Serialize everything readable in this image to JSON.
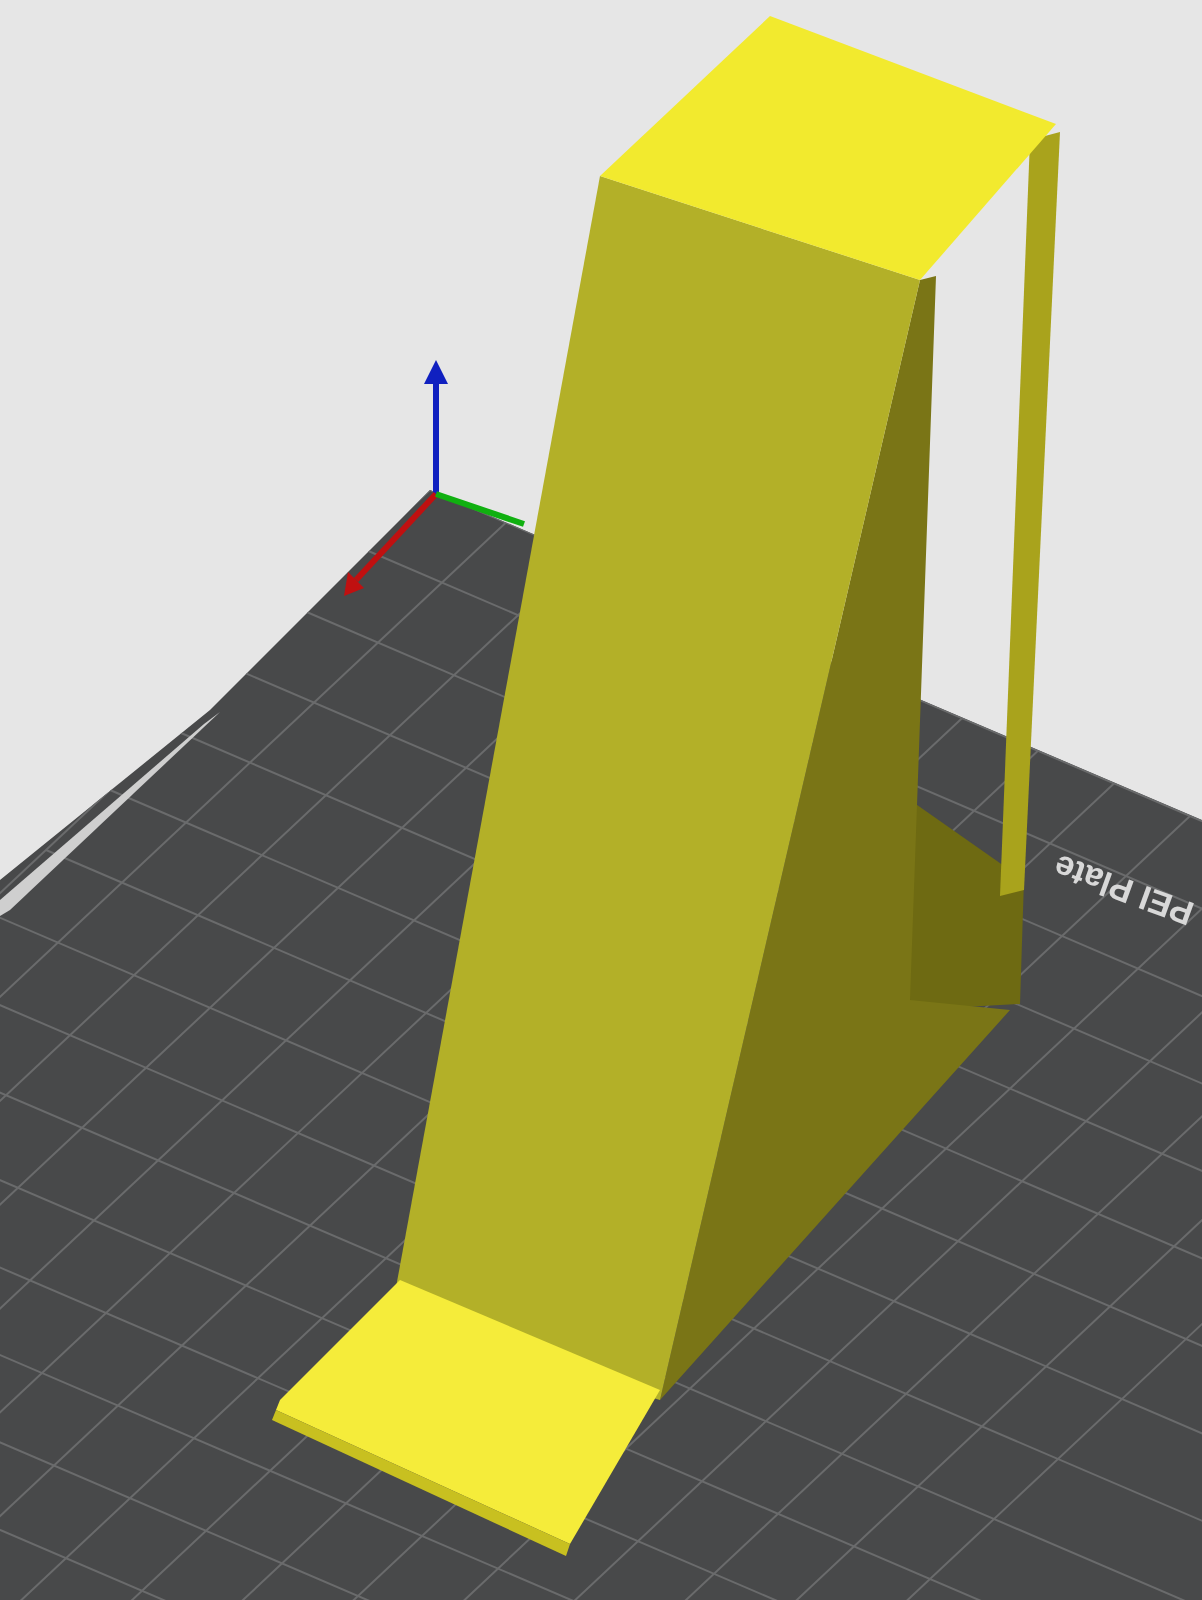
{
  "viewport": {
    "bed_label": "PEI Plate"
  }
}
